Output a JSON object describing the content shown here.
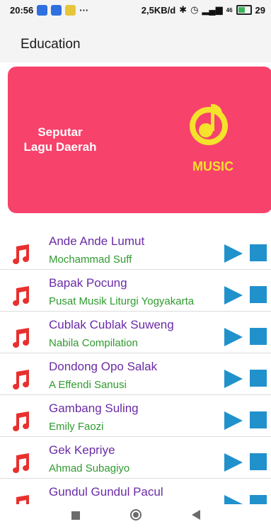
{
  "status_bar": {
    "time": "20:56",
    "dots": "···",
    "speed": "2,5KB/d",
    "signal": "46",
    "battery": "29"
  },
  "app_bar": {
    "title": "Education"
  },
  "banner": {
    "title": "Seputar\nLagu Daerah",
    "logo_text": "MUSIC",
    "background_color": "#f7426b",
    "logo_color": "#f5e22b"
  },
  "songs": [
    {
      "title": "Ande Ande Lumut",
      "artist": "Mochammad Suff"
    },
    {
      "title": "Bapak Pocung",
      "artist": "Pusat Musik Liturgi Yogyakarta"
    },
    {
      "title": "Cublak Cublak Suweng",
      "artist": "Nabila Compilation"
    },
    {
      "title": "Dondong Opo Salak",
      "artist": "A Effendi Sanusi"
    },
    {
      "title": "Gambang Suling",
      "artist": "Emily Faozi"
    },
    {
      "title": "Gek Kepriye",
      "artist": "Ahmad Subagiyo"
    },
    {
      "title": "Gundul Gundul Pacul",
      "artist": ""
    }
  ],
  "icons": {
    "note": "music-note-icon",
    "play": "play-icon",
    "stop": "stop-icon",
    "nav_recents": "square-icon",
    "nav_home": "circle-icon",
    "nav_back": "triangle-back-icon"
  },
  "colors": {
    "title_purple": "#6a2ba6",
    "artist_green": "#2f9a2f",
    "note_red": "#e8302e",
    "control_blue": "#2191cc"
  }
}
